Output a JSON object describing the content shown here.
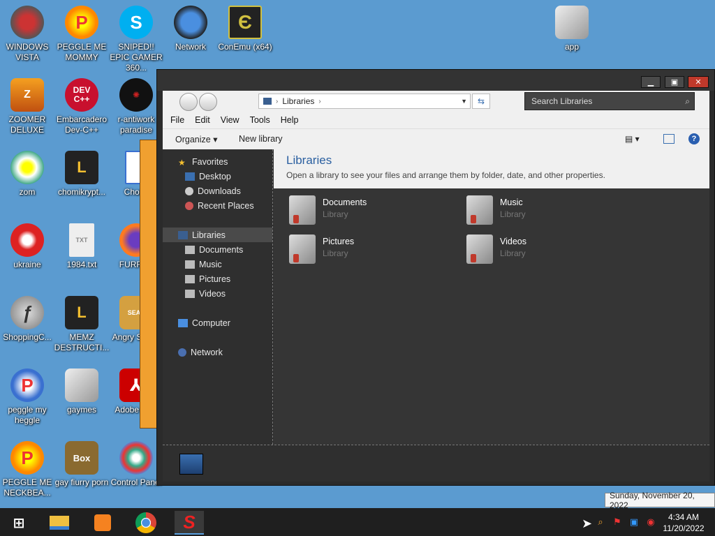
{
  "desktop": {
    "icons": [
      {
        "label": "WINDOWS VISTA"
      },
      {
        "label": "PEGGLE ME MOMMY"
      },
      {
        "label": "SNIPED!! EPIC GAMER 360..."
      },
      {
        "label": "Network"
      },
      {
        "label": "ConEmu (x64)"
      },
      {
        "label": "app"
      },
      {
        "label": "ZOOMER DELUXE"
      },
      {
        "label": "Embarcadero Dev-C++"
      },
      {
        "label": "r-antiwork paradise"
      },
      {
        "label": "zom"
      },
      {
        "label": "chomikrypt..."
      },
      {
        "label": "Chomi"
      },
      {
        "label": "ukraine"
      },
      {
        "label": "1984.txt"
      },
      {
        "label": "FURRYF"
      },
      {
        "label": "ShoppingC..."
      },
      {
        "label": "MEMZ DESTRUCTI..."
      },
      {
        "label": "Angry Seaso"
      },
      {
        "label": "peggle my heggle"
      },
      {
        "label": "gaymes"
      },
      {
        "label": "Adobe R XI"
      },
      {
        "label": "PEGGLE ME NECKBEA..."
      },
      {
        "label": "gay fiurry porn"
      },
      {
        "label": "Control Panel"
      }
    ]
  },
  "window": {
    "min_glyph": "▁",
    "max_glyph": "▣",
    "close_glyph": "✕",
    "address": {
      "crumb": "Libraries",
      "sep1": "›",
      "sep2": "›"
    },
    "search_placeholder": "Search Libraries",
    "menu": {
      "file": "File",
      "edit": "Edit",
      "view": "View",
      "tools": "Tools",
      "help": "Help"
    },
    "toolbar": {
      "organize": "Organize ▾",
      "new_library": "New library",
      "views": "▤ ▾",
      "help": "?"
    },
    "nav": {
      "favorites": "Favorites",
      "desktop": "Desktop",
      "downloads": "Downloads",
      "recent": "Recent Places",
      "libraries": "Libraries",
      "documents": "Documents",
      "music": "Music",
      "pictures": "Pictures",
      "videos": "Videos",
      "computer": "Computer",
      "network": "Network"
    },
    "content": {
      "title": "Libraries",
      "subtitle": "Open a library to see your files and arrange them by folder, date, and other properties.",
      "items": [
        {
          "name": "Documents",
          "kind": "Library"
        },
        {
          "name": "Music",
          "kind": "Library"
        },
        {
          "name": "Pictures",
          "kind": "Library"
        },
        {
          "name": "Videos",
          "kind": "Library"
        }
      ]
    }
  },
  "taskbar": {
    "time": "4:34 AM",
    "date": "11/20/2022",
    "tooltip": "Sunday, November 20, 2022",
    "start_glyph": "⊞",
    "s_glyph": "S"
  },
  "colors": {
    "desktop": "#5b9bd0",
    "accent": "#2a5fa0",
    "close": "#c0392b"
  }
}
